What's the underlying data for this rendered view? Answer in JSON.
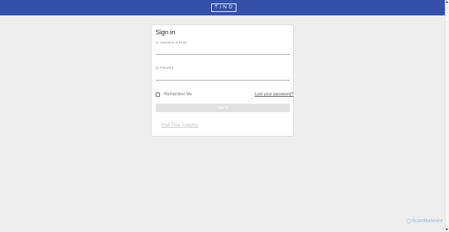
{
  "header": {
    "logo_text": "TIND",
    "background_color": "#3450a8"
  },
  "login": {
    "title": "Sign in",
    "username_label": "Username or Email",
    "username_value": "",
    "password_label": "Password",
    "password_value": "",
    "remember_label": "Remember Me",
    "remember_checked": false,
    "lost_password_link": "Lost your password?",
    "submit_label": "Sign In",
    "rta_link": "Real Time Analytics"
  },
  "icons": {
    "username": "user-icon",
    "password": "lock-icon",
    "watermark": "scanmalware-logo-icon"
  },
  "watermark": {
    "text": "ScanMalware"
  }
}
